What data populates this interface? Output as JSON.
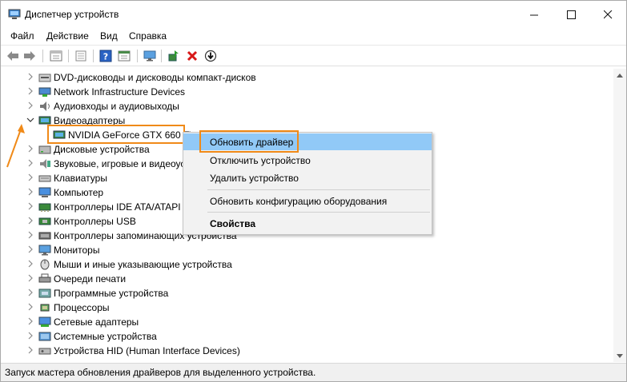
{
  "window": {
    "title": "Диспетчер устройств",
    "controls": {
      "minimize": "—",
      "maximize": "☐",
      "close": "✕"
    }
  },
  "menu": [
    "Файл",
    "Действие",
    "Вид",
    "Справка"
  ],
  "toolbar_icons": [
    "back-icon",
    "forward-icon",
    "properties-pane-icon",
    "list-icon",
    "help-icon",
    "details-icon",
    "monitor-icon",
    "update-driver-icon",
    "remove-icon",
    "install-icon"
  ],
  "tree": [
    {
      "label": "DVD-дисководы и дисководы компакт-дисков",
      "icon": "dvd-icon",
      "expanded": false
    },
    {
      "label": "Network Infrastructure Devices",
      "icon": "network-device-icon",
      "expanded": false
    },
    {
      "label": "Аудиовходы и аудиовыходы",
      "icon": "speaker-icon",
      "expanded": false
    },
    {
      "label": "Видеоадаптеры",
      "icon": "display-adapter-icon",
      "expanded": true
    },
    {
      "label": "NVIDIA GeForce GTX 660 Ti",
      "icon": "display-adapter-icon",
      "child": true,
      "selected": true
    },
    {
      "label": "Дисковые устройства",
      "icon": "disk-icon",
      "expanded": false
    },
    {
      "label": "Звуковые, игровые и видеоустройства",
      "icon": "sound-icon",
      "expanded": false
    },
    {
      "label": "Клавиатуры",
      "icon": "keyboard-icon",
      "expanded": false
    },
    {
      "label": "Компьютер",
      "icon": "computer-icon",
      "expanded": false
    },
    {
      "label": "Контроллеры IDE ATA/ATAPI",
      "icon": "ide-controller-icon",
      "expanded": false
    },
    {
      "label": "Контроллеры USB",
      "icon": "usb-controller-icon",
      "expanded": false
    },
    {
      "label": "Контроллеры запоминающих устройства",
      "icon": "storage-controller-icon",
      "expanded": false
    },
    {
      "label": "Мониторы",
      "icon": "monitor-icon",
      "expanded": false
    },
    {
      "label": "Мыши и иные указывающие устройства",
      "icon": "mouse-icon",
      "expanded": false
    },
    {
      "label": "Очереди печати",
      "icon": "printer-icon",
      "expanded": false
    },
    {
      "label": "Программные устройства",
      "icon": "software-device-icon",
      "expanded": false
    },
    {
      "label": "Процессоры",
      "icon": "processor-icon",
      "expanded": false
    },
    {
      "label": "Сетевые адаптеры",
      "icon": "network-adapter-icon",
      "expanded": false
    },
    {
      "label": "Системные устройства",
      "icon": "system-device-icon",
      "expanded": false
    },
    {
      "label": "Устройства HID (Human Interface Devices)",
      "icon": "hid-icon",
      "expanded": false
    }
  ],
  "context_menu": {
    "update_driver": "Обновить драйвер",
    "disable_device": "Отключить устройство",
    "uninstall_device": "Удалить устройство",
    "scan_hardware": "Обновить конфигурацию оборудования",
    "properties": "Свойства"
  },
  "status": "Запуск мастера обновления драйверов для выделенного устройства.",
  "colors": {
    "accent": "#f08a18",
    "menu_hover": "#91c9f7",
    "selection_border": "#f08a18"
  }
}
